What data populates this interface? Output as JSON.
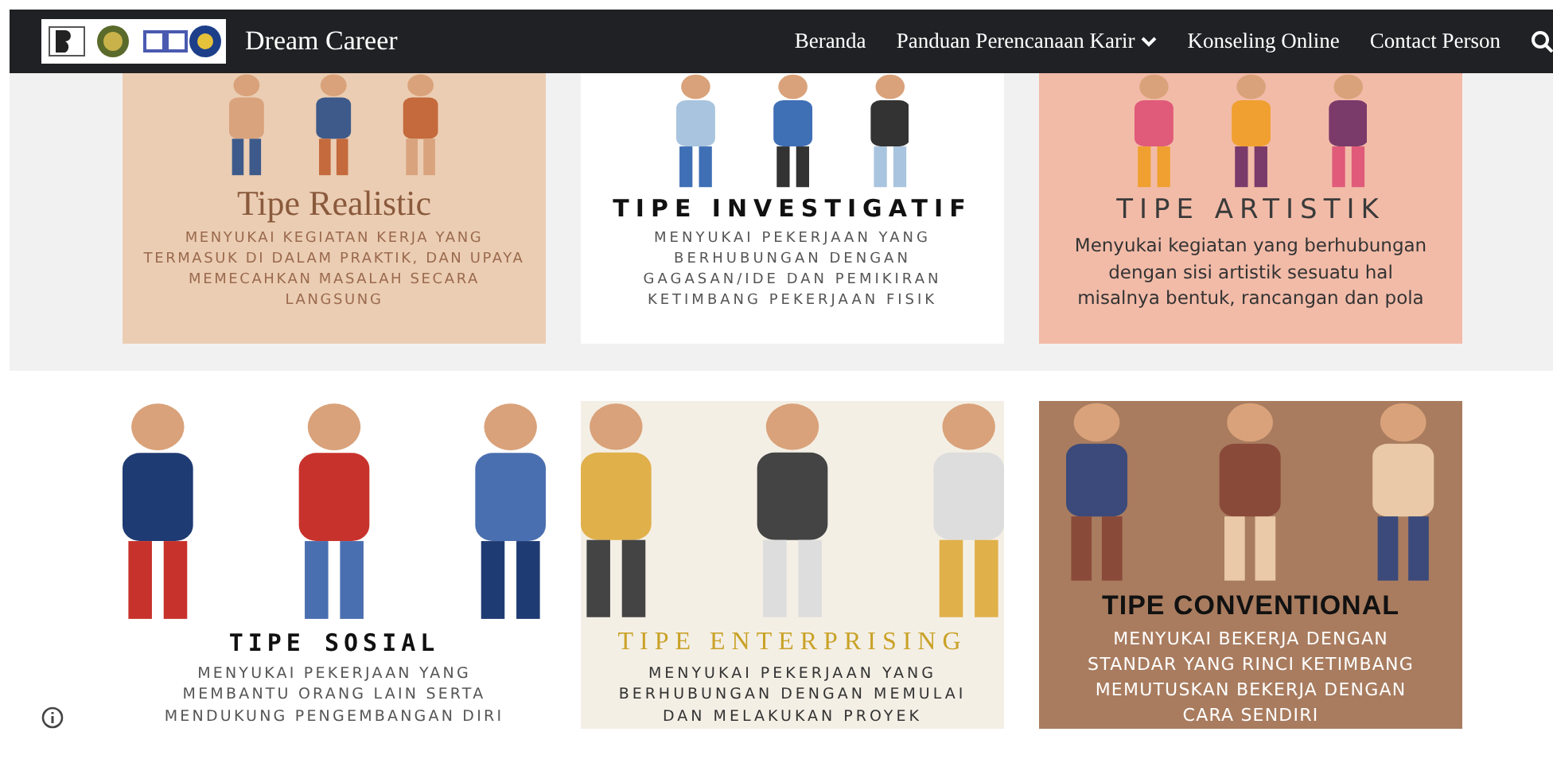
{
  "header": {
    "site_title": "Dream Career",
    "nav": [
      {
        "label": "Beranda",
        "dropdown": false
      },
      {
        "label": "Panduan Perencanaan Karir",
        "dropdown": true
      },
      {
        "label": "Konseling Online",
        "dropdown": false
      },
      {
        "label": "Contact Person",
        "dropdown": false
      }
    ]
  },
  "sections": [
    {
      "kind": "grey",
      "cards": [
        {
          "kind": "realistic",
          "title": "Tipe Realistic",
          "description": "MENYUKAI KEGIATAN KERJA YANG\nTERMASUK DI DALAM PRAKTIK, DAN UPAYA\nMEMECAHKAN MASALAH SECARA\nLANGSUNG"
        },
        {
          "kind": "investigatif",
          "title": "TIPE INVESTIGATIF",
          "description": "MENYUKAI PEKERJAAN YANG\nBERHUBUNGAN DENGAN\nGAGASAN/IDE DAN PEMIKIRAN\nKETIMBANG PEKERJAAN FISIK"
        },
        {
          "kind": "artistik",
          "title": "TIPE ARTISTIK",
          "description": "Menyukai kegiatan yang berhubungan\ndengan sisi artistik sesuatu hal\nmisalnya bentuk, rancangan dan pola"
        }
      ]
    },
    {
      "kind": "white",
      "cards": [
        {
          "kind": "sosial",
          "title": "TIPE SOSIAL",
          "description": "MENYUKAI PEKERJAAN YANG\nMEMBANTU ORANG LAIN SERTA\nMENDUKUNG PENGEMBANGAN DIRI"
        },
        {
          "kind": "enterprising",
          "title": "TIPE ENTERPRISING",
          "description": "MENYUKAI PEKERJAAN YANG\nBERHUBUNGAN DENGAN MEMULAI\nDAN MELAKUKAN PROYEK"
        },
        {
          "kind": "conventional",
          "title": "TIPE CONVENTIONAL",
          "description": "MENYUKAI BEKERJA DENGAN\nSTANDAR YANG RINCI KETIMBANG\nMEMUTUSKAN BEKERJA DENGAN\nCARA SENDIRI"
        }
      ]
    }
  ]
}
